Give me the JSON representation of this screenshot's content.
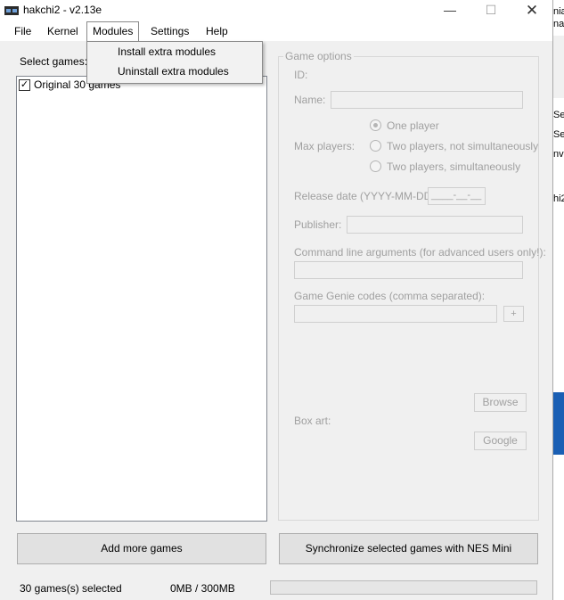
{
  "window": {
    "title": "hakchi2 - v2.13e",
    "minimize_symbol": "—",
    "maximize_symbol": "☐",
    "close_symbol": "✕"
  },
  "menu": {
    "items": [
      {
        "label": "File"
      },
      {
        "label": "Kernel"
      },
      {
        "label": "Modules"
      },
      {
        "label": "Settings"
      },
      {
        "label": "Help"
      }
    ],
    "dropdown": [
      {
        "label": "Install extra modules"
      },
      {
        "label": "Uninstall extra modules"
      }
    ]
  },
  "left": {
    "select_label": "Select games:",
    "games": [
      {
        "label": "Original 30 games",
        "checked": true,
        "check_symbol": "✓"
      }
    ]
  },
  "options": {
    "legend": "Game options",
    "id_label": "ID:",
    "name_label": "Name:",
    "max_players_label": "Max players:",
    "radios": [
      {
        "label": "One player",
        "selected": true
      },
      {
        "label": "Two players, not simultaneously",
        "selected": false
      },
      {
        "label": "Two players, simultaneously",
        "selected": false
      }
    ],
    "release_label": "Release date (YYYY-MM-DD):",
    "release_value": "____-__-__",
    "publisher_label": "Publisher:",
    "args_label": "Command line arguments (for advanced users only!):",
    "genie_label": "Game Genie codes (comma separated):",
    "genie_add": "+",
    "browse": "Browse",
    "boxart_label": "Box art:",
    "google": "Google"
  },
  "buttons": {
    "add_games": "Add more games",
    "sync": "Synchronize selected games with NES Mini"
  },
  "status": {
    "selected": "30 games(s) selected",
    "size": "0MB / 300MB",
    "progress_fraction": 0
  },
  "background_fragments": {
    "a": "nia",
    "b": "na",
    "c": "Sel",
    "d": "Sel",
    "e": "nv",
    "f": "hi2"
  }
}
